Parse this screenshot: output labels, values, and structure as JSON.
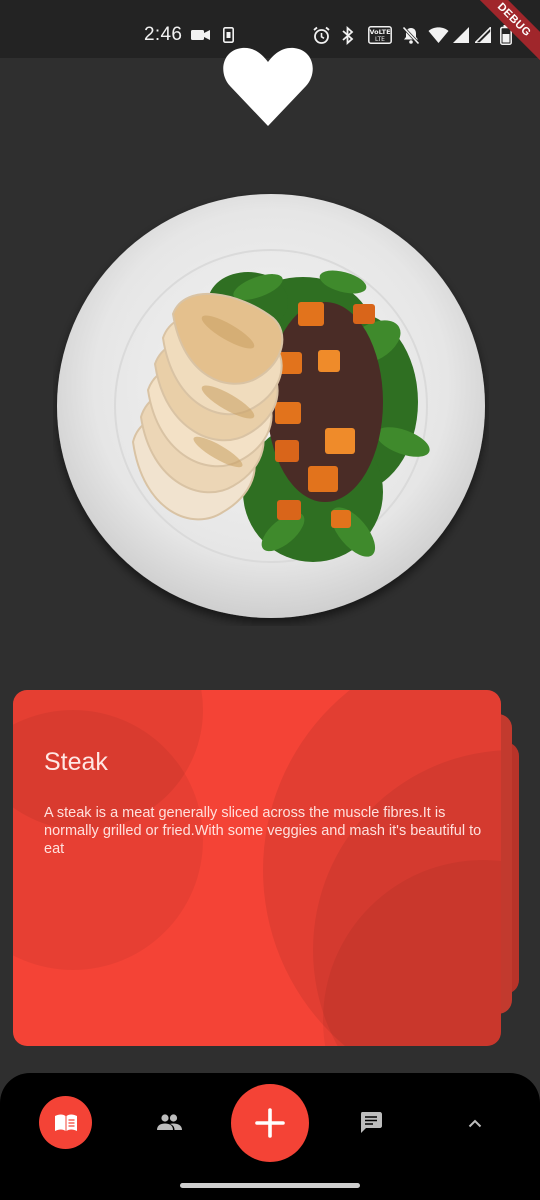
{
  "status_bar": {
    "time": "2:46",
    "debug_label": "DEBUG",
    "icons": [
      "video-icon",
      "sim-icon",
      "alarm-icon",
      "bluetooth-icon",
      "volte-icon",
      "mute-icon",
      "wifi-icon",
      "signal-icon",
      "signal-2-icon",
      "battery-icon"
    ]
  },
  "favorite": {
    "icon": "heart-icon",
    "color": "#ffffff"
  },
  "dish_image": {
    "icon": "plate-food-image"
  },
  "card": {
    "title": "Steak",
    "description": "A steak is a meat generally sliced across the muscle fibres.It is normally grilled or fried.With some veggies and mash it's beautiful to eat",
    "color": "#f44336"
  },
  "bottom_nav": {
    "items": [
      {
        "icon": "book-icon",
        "active": true
      },
      {
        "icon": "people-icon",
        "active": false
      },
      {
        "icon": "add-icon",
        "active": false
      },
      {
        "icon": "chat-icon",
        "active": false
      },
      {
        "icon": "chevron-up-icon",
        "active": false
      }
    ],
    "accent": "#f44336"
  }
}
